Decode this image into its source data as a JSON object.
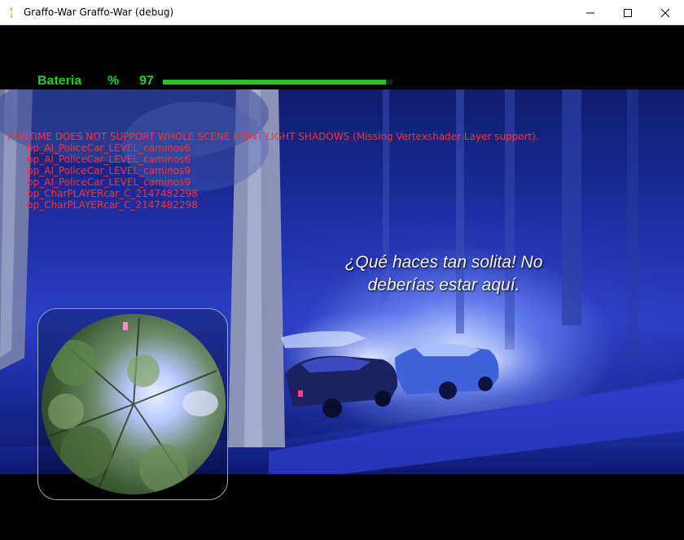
{
  "window": {
    "title": "Graffo-War Graffo-War (debug)"
  },
  "hud": {
    "battery_label": "Bateria",
    "battery_unit": "%",
    "battery_value": "97",
    "battery_level": 0.97,
    "accent": "#1ec81e"
  },
  "debug": {
    "header": "RUNTIME DOES NOT SUPPORT WHOLE SCENE POINT LIGHT SHADOWS (Missing Vertexshader Layer support).",
    "lines": [
      "bp_AI_PoliceCar_LEVEL_caminos6",
      "bp_AI_PoliceCar_LEVEL_caminos6",
      "bp_AI_PoliceCar_LEVEL_caminos9",
      "bp_AI_PoliceCar_LEVEL_caminos9",
      "bp_CharPLAYERcar_C_2147482298",
      "bp_CharPLAYERcar_C_2147482298"
    ],
    "color": "#ff3030"
  },
  "subtitle": {
    "line1": "¿Qué haces tan solita! No",
    "line2": "deberías estar aquí."
  }
}
